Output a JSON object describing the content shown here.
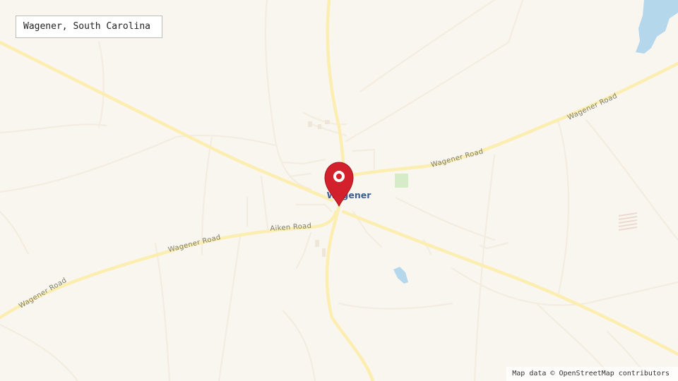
{
  "map": {
    "place_name": "Wagener, South Carolina",
    "town_label": "Wagener",
    "road_labels": {
      "wagener_road_ne_lower": "Wagener Road",
      "wagener_road_ne_upper": "Wagener Road",
      "aiken_road": "Aiken Road",
      "wagener_road_sw_upper": "Wagener Road",
      "wagener_road_sw_lower": "Wagener Road"
    },
    "attribution": "Map data © OpenStreetMap contributors",
    "marker_icon": "map-pin-icon",
    "colors": {
      "background": "#f9f6ef",
      "major_road": "#fbeeb0",
      "minor_road": "#f3ece0",
      "water": "#b5d7ec",
      "park": "#d6ebc8",
      "marker": "#d2202c",
      "town_label": "#3c5f97"
    }
  }
}
